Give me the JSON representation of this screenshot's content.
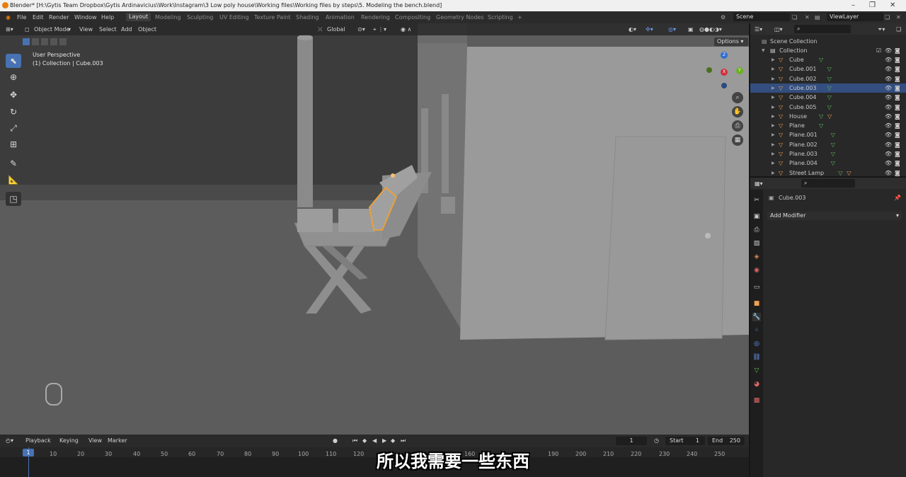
{
  "window": {
    "title": "Blender* [H:\\Gytis Team Dropbox\\Gytis Ardinavicius\\Work\\Instagram\\3 Low poly house\\Working files\\Working files by steps\\5. Modeling the bench.blend]",
    "minimize": "–",
    "maximize": "❐",
    "close": "✕"
  },
  "menu": [
    "File",
    "Edit",
    "Render",
    "Window",
    "Help"
  ],
  "workspaces": [
    "Layout",
    "Modeling",
    "Sculpting",
    "UV Editing",
    "Texture Paint",
    "Shading",
    "Animation",
    "Rendering",
    "Compositing",
    "Geometry Nodes",
    "Scripting",
    "+"
  ],
  "scene": {
    "label": "Scene",
    "view_layer": "ViewLayer"
  },
  "viewport_header": {
    "mode": "Object Mode",
    "menus": [
      "View",
      "Select",
      "Add",
      "Object"
    ],
    "orientation": "Global",
    "options": "Options"
  },
  "viewport": {
    "perspective": "User Perspective",
    "collection_info": "(1) Collection | Cube.003"
  },
  "gizmo": {
    "x": "X",
    "y": "Y",
    "z": "Z"
  },
  "outliner": {
    "scene_collection": "Scene Collection",
    "collection": "Collection",
    "items": [
      {
        "name": "Cube"
      },
      {
        "name": "Cube.001"
      },
      {
        "name": "Cube.002"
      },
      {
        "name": "Cube.003"
      },
      {
        "name": "Cube.004"
      },
      {
        "name": "Cube.005"
      },
      {
        "name": "House"
      },
      {
        "name": "Plane"
      },
      {
        "name": "Plane.001"
      },
      {
        "name": "Plane.002"
      },
      {
        "name": "Plane.003"
      },
      {
        "name": "Plane.004"
      },
      {
        "name": "Street Lamp"
      }
    ]
  },
  "properties": {
    "object_name": "Cube.003",
    "add_modifier": "Add Modifier"
  },
  "timeline": {
    "menus": [
      "Playback",
      "Keying",
      "View",
      "Marker"
    ],
    "current_frame": "1",
    "start_label": "Start",
    "start": "1",
    "end_label": "End",
    "end": "250",
    "ticks": [
      "1",
      "10",
      "20",
      "30",
      "40",
      "50",
      "60",
      "70",
      "80",
      "90",
      "100",
      "110",
      "120",
      "160",
      "190",
      "200",
      "210",
      "220",
      "230",
      "240",
      "250"
    ]
  },
  "subtitle": "所以我需要一些东西",
  "colors": {
    "accent": "#4772b3",
    "selected_outline": "#e8a13a",
    "viewport_bg": "#5a5a5a"
  }
}
